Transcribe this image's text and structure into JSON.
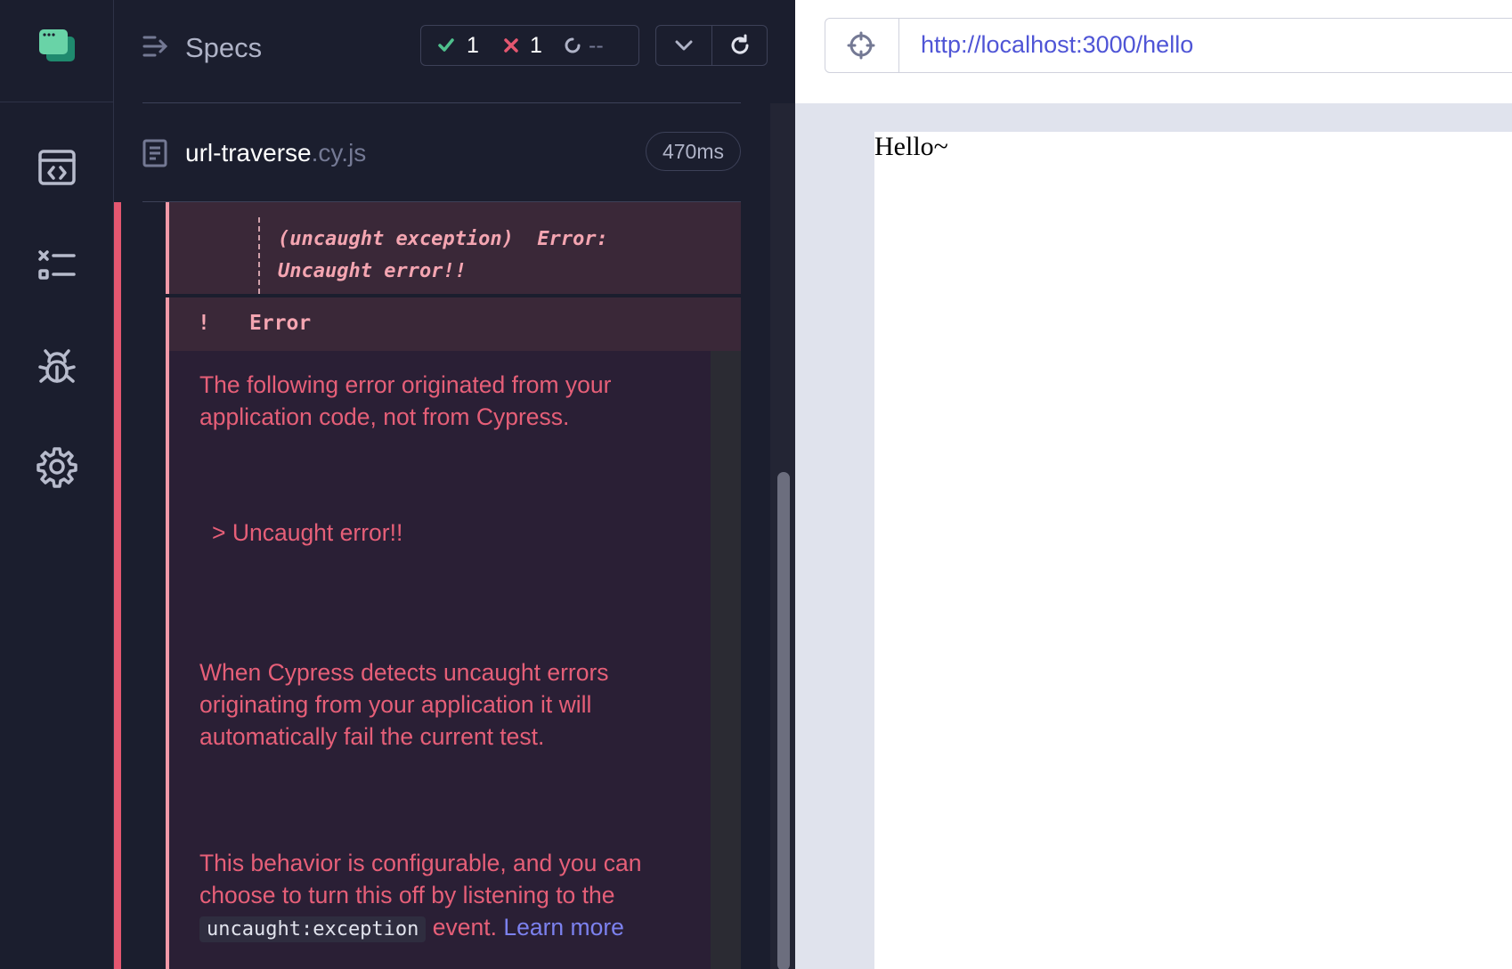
{
  "sidebar": {
    "items": [
      {
        "icon": "code-window-icon"
      },
      {
        "icon": "spec-list-icon"
      },
      {
        "icon": "bug-icon"
      },
      {
        "icon": "gear-icon"
      }
    ]
  },
  "reporter": {
    "specs_label": "Specs",
    "stats": {
      "passed": "1",
      "failed": "1",
      "pending": "--"
    },
    "file": {
      "name": "url-traverse",
      "ext": ".cy.js",
      "duration": "470ms"
    },
    "exception_text": "(uncaught exception)  Error:\nUncaught error!!",
    "error_title": "Error",
    "error_icon": "!",
    "error_body": {
      "p1": "The following error originated from your application code, not from Cypress.",
      "p2": "> Uncaught error!!",
      "p3": "When Cypress detects uncaught errors originating from your application it will automatically fail the current test.",
      "p4_before": "This behavior is configurable, and you can choose to turn this off by listening to the",
      "p4_code": "uncaught:exception",
      "p4_after": "event.",
      "p4_link": "Learn more"
    }
  },
  "aut": {
    "url": "http://localhost:3000/hello",
    "page_text": "Hello~"
  },
  "colors": {
    "pass": "#4fc08d",
    "fail": "#e45770",
    "link": "#4f55d6",
    "error_text": "#e65f78"
  }
}
